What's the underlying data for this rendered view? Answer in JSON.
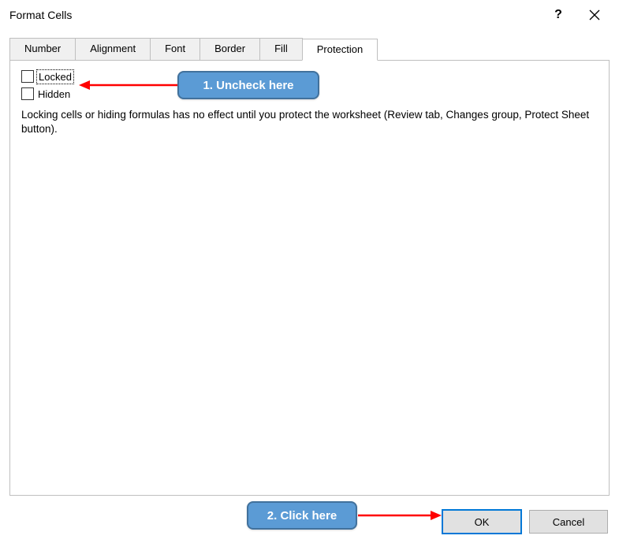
{
  "window": {
    "title": "Format Cells"
  },
  "tabs": [
    {
      "label": "Number"
    },
    {
      "label": "Alignment"
    },
    {
      "label": "Font"
    },
    {
      "label": "Border"
    },
    {
      "label": "Fill"
    },
    {
      "label": "Protection"
    }
  ],
  "protection": {
    "locked_label": "Locked",
    "hidden_label": "Hidden",
    "help_text": "Locking cells or hiding formulas has no effect until you protect the worksheet (Review tab, Changes group, Protect Sheet button)."
  },
  "buttons": {
    "ok": "OK",
    "cancel": "Cancel"
  },
  "annotations": {
    "callout1": "1. Uncheck here",
    "callout2": "2. Click here"
  }
}
